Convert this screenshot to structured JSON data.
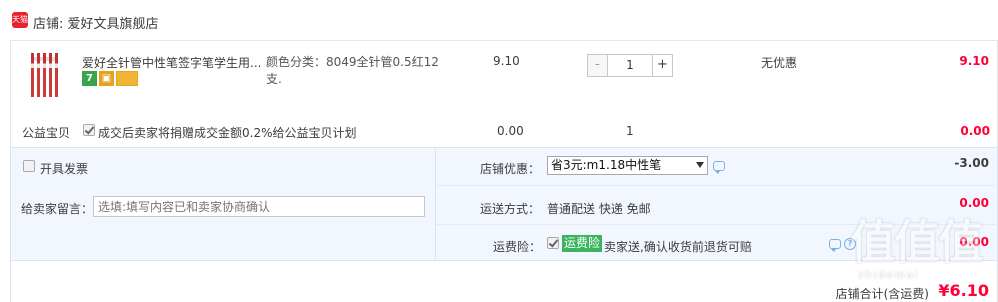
{
  "shop": {
    "logo_text": "天猫",
    "label": "店铺: 爱好文具旗舰店"
  },
  "item": {
    "title": "爱好全针管中性笔签字笔学生用...",
    "attributes": "颜色分类：8049全针管0.5红12支.",
    "price": "9.10",
    "quantity": "1",
    "minus_label": "-",
    "plus_label": "+",
    "discount": "无优惠",
    "subtotal": "9.10",
    "badges": [
      "seven-day-return-icon",
      "gift-icon",
      "card-icon"
    ]
  },
  "charity": {
    "label": "公益宝贝",
    "text": "成交后卖家将捐赠成交金额0.2%给公益宝贝计划",
    "amount": "0.00",
    "quantity": "1",
    "subtotal": "0.00"
  },
  "options": {
    "invoice_label": "开具发票",
    "message_label": "给卖家留言：",
    "message_placeholder": "选填:填写内容已和卖家协商确认",
    "coupon_label": "店铺优惠：",
    "coupon_selected": "省3元:m1.18中性笔",
    "coupon_amount": "-3.00",
    "shipping_label": "运送方式：",
    "shipping_value": "普通配送 快递 免邮",
    "shipping_amount": "0.00",
    "insurance_label": "运费险：",
    "insurance_tag": "运费险",
    "insurance_text": "卖家送,确认收货前退货可赔",
    "insurance_amount": "0.00"
  },
  "total": {
    "label": "店铺合计(含运费)",
    "amount": "¥6.10"
  },
  "watermark": {
    "main": "值值值",
    "sub": "zhidemai"
  },
  "colors": {
    "accent_red": "#ff0036",
    "options_bg": "#f2f7ff",
    "insurance_green": "#3ab55d"
  }
}
